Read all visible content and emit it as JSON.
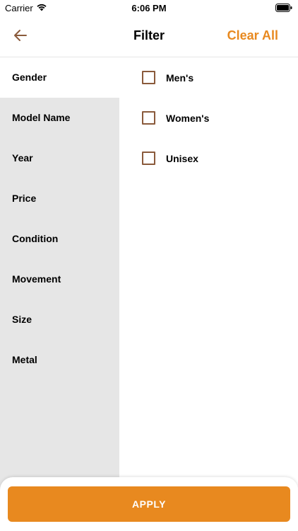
{
  "status_bar": {
    "carrier": "Carrier",
    "time": "6:06 PM",
    "icons": [
      "wifi-icon",
      "battery-icon"
    ]
  },
  "nav": {
    "title": "Filter",
    "clear_label": "Clear All",
    "back_icon": "arrow-left-icon"
  },
  "sidebar": {
    "items": [
      {
        "label": "Gender",
        "active": true
      },
      {
        "label": "Model Name",
        "active": false
      },
      {
        "label": "Year",
        "active": false
      },
      {
        "label": "Price",
        "active": false
      },
      {
        "label": "Condition",
        "active": false
      },
      {
        "label": "Movement",
        "active": false
      },
      {
        "label": "Size",
        "active": false
      },
      {
        "label": "Metal",
        "active": false
      }
    ]
  },
  "options": {
    "items": [
      {
        "label": "Men's",
        "checked": false
      },
      {
        "label": "Women's",
        "checked": false
      },
      {
        "label": "Unisex",
        "checked": false
      }
    ]
  },
  "footer": {
    "apply_label": "APPLY"
  },
  "colors": {
    "accent": "#e8891f",
    "checkbox_border": "#8a5a3b",
    "sidebar_bg": "#e6e6e6",
    "back_arrow": "#8a5a3b"
  }
}
